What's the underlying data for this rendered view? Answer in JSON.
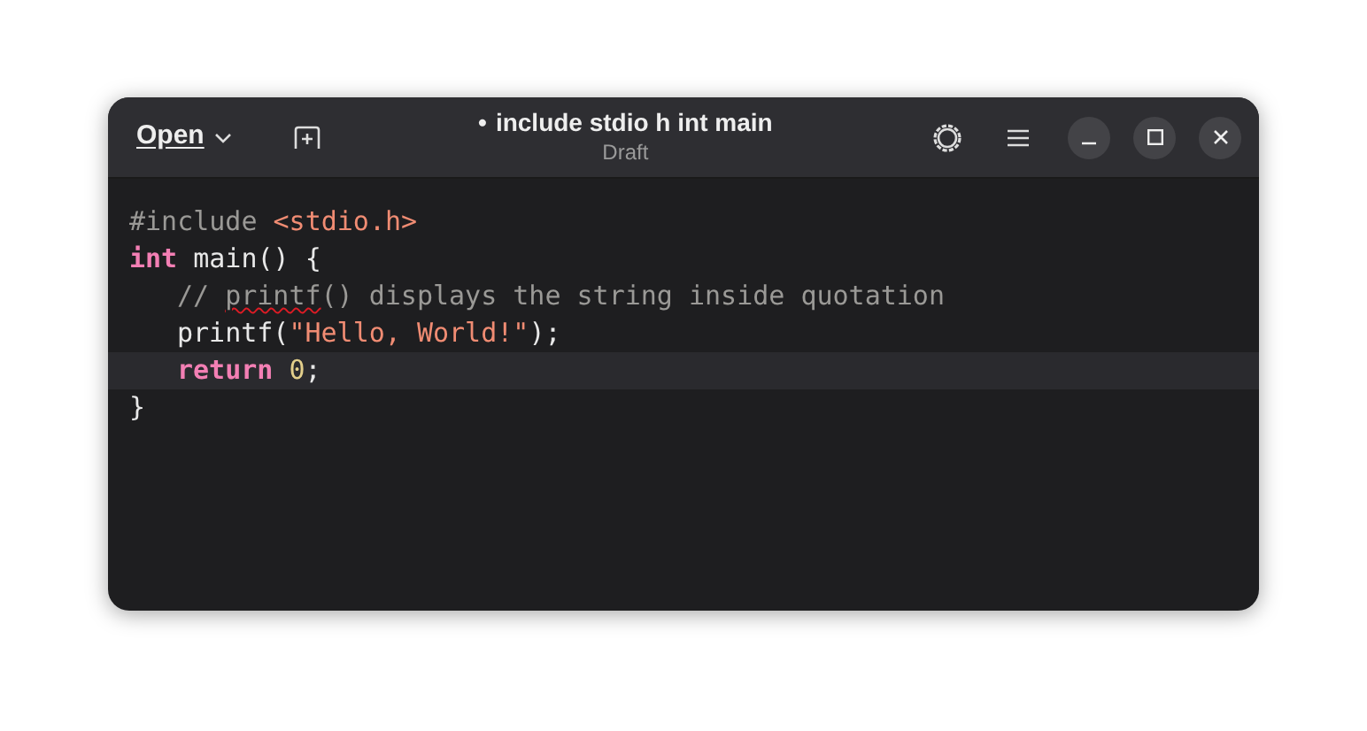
{
  "header": {
    "open_button": "Open",
    "modified_mark": "•",
    "title": "include stdio h int main",
    "subtitle": "Draft"
  },
  "editor": {
    "lines": [
      {
        "current": false,
        "tokens": [
          {
            "kind": "preproc",
            "text": "#include "
          },
          {
            "kind": "string",
            "text": "<stdio.h>"
          }
        ]
      },
      {
        "current": false,
        "tokens": [
          {
            "kind": "keyword",
            "text": "int"
          },
          {
            "kind": "plain",
            "text": " main() {"
          }
        ],
        "children": [
          {
            "current": false,
            "tokens": [
              {
                "kind": "comment",
                "text": "// "
              },
              {
                "kind": "comment",
                "text": "printf",
                "misspelled": true
              },
              {
                "kind": "comment",
                "text": "() displays the string inside quotation"
              }
            ]
          },
          {
            "current": false,
            "tokens": [
              {
                "kind": "plain",
                "text": "printf("
              },
              {
                "kind": "string",
                "text": "\"Hello, World!\""
              },
              {
                "kind": "plain",
                "text": ");"
              }
            ]
          },
          {
            "current": true,
            "tokens": [
              {
                "kind": "keyword",
                "text": "return "
              },
              {
                "kind": "number",
                "text": "0"
              },
              {
                "kind": "plain",
                "text": ";"
              }
            ]
          }
        ]
      },
      {
        "current": false,
        "tokens": [
          {
            "kind": "plain",
            "text": "}"
          }
        ]
      }
    ]
  }
}
